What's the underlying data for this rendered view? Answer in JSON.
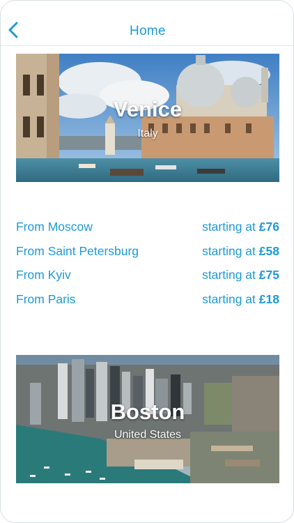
{
  "header": {
    "title": "Home"
  },
  "destinations": [
    {
      "city": "Venice",
      "country": "Italy",
      "routes": [
        {
          "from": "From Moscow",
          "starting": "starting at",
          "price": "£76"
        },
        {
          "from": "From Saint Petersburg",
          "starting": "starting at",
          "price": "£58"
        },
        {
          "from": "From Kyiv",
          "starting": "starting at",
          "price": "£75"
        },
        {
          "from": "From Paris",
          "starting": "starting at",
          "price": "£18"
        }
      ]
    },
    {
      "city": "Boston",
      "country": "United States"
    }
  ],
  "colors": {
    "accent": "#1c9ad6",
    "divider": "#e3e7ea"
  },
  "icons": {
    "back": "chevron-left-icon"
  }
}
